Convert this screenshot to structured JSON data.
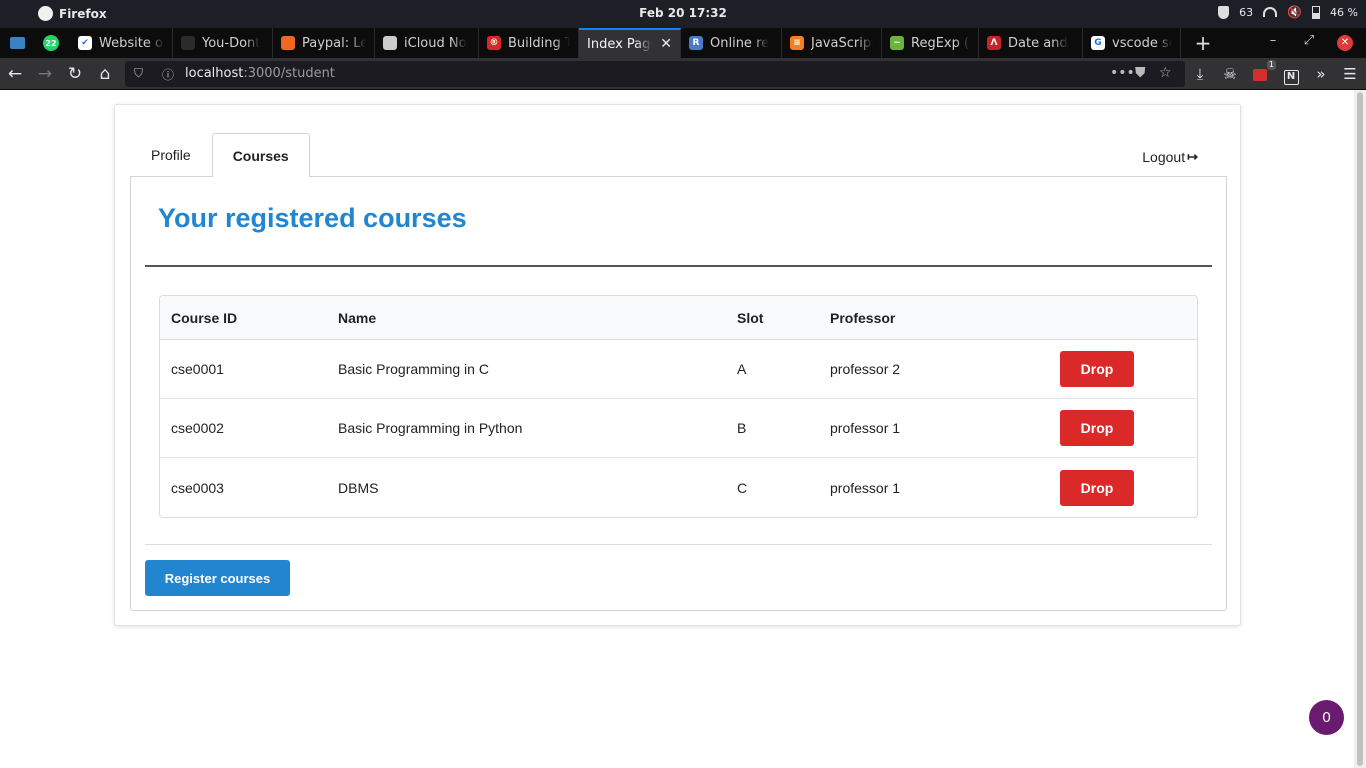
{
  "os": {
    "app_name": "Firefox",
    "clock": "Feb 20  17:32",
    "tray_value": "63",
    "battery": "46 %"
  },
  "pinned": [
    {
      "icon": "monitor-icon"
    },
    {
      "icon": "whatsapp-icon",
      "badge": "22"
    }
  ],
  "tabs": [
    {
      "label": "Website or",
      "icon": "checkbox-icon",
      "color": "#ffffff"
    },
    {
      "label": "You-Dont",
      "icon": "github-icon",
      "color": "#2b2b2b"
    },
    {
      "label": "Paypal: Le",
      "icon": "flame-icon",
      "color": "#f26722"
    },
    {
      "label": "iCloud No",
      "icon": "apple-icon",
      "color": "#cccccc"
    },
    {
      "label": "Building T",
      "icon": "react-icon",
      "color": "#d62828"
    },
    {
      "label": "Index Page",
      "icon": "none",
      "color": "#323234",
      "active": true
    },
    {
      "label": "Online re",
      "icon": "r-icon",
      "color": "#4a7bc8"
    },
    {
      "label": "JavaScript",
      "icon": "stackoverflow-icon",
      "color": "#f48024"
    },
    {
      "label": "RegExp (X",
      "icon": "regexp-icon",
      "color": "#6cb33e"
    },
    {
      "label": "Date and",
      "icon": "figure-icon",
      "color": "#c0262c"
    },
    {
      "label": "vscode se",
      "icon": "google-icon",
      "color": "#ffffff"
    }
  ],
  "nav": {
    "url_host": "localhost",
    "url_path": ":3000/student",
    "ext_badge": "1"
  },
  "page": {
    "tabs": [
      {
        "label": "Profile"
      },
      {
        "label": "Courses",
        "active": true
      }
    ],
    "logout_label": "Logout",
    "heading": "Your registered courses",
    "table": {
      "headers": [
        "Course ID",
        "Name",
        "Slot",
        "Professor"
      ],
      "rows": [
        {
          "id": "cse0001",
          "name": "Basic Programming in C",
          "slot": "A",
          "professor": "professor 2",
          "action": "Drop"
        },
        {
          "id": "cse0002",
          "name": "Basic Programming in Python",
          "slot": "B",
          "professor": "professor 1",
          "action": "Drop"
        },
        {
          "id": "cse0003",
          "name": "DBMS",
          "slot": "C",
          "professor": "professor 1",
          "action": "Drop"
        }
      ]
    },
    "register_label": "Register courses",
    "fab_count": "0"
  },
  "colors": {
    "primary": "#2185d0",
    "danger": "#db2828",
    "fab": "#6a1b6f"
  }
}
